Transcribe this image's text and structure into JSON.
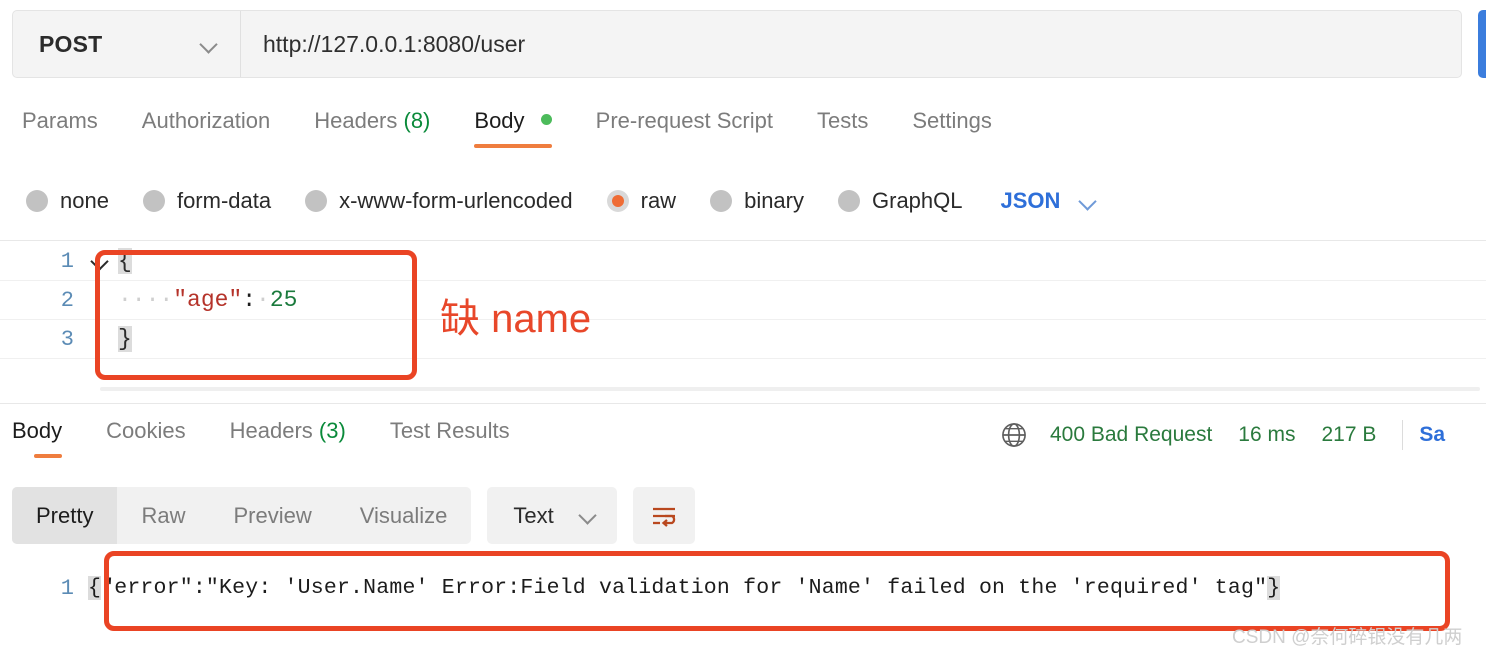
{
  "request": {
    "method": "POST",
    "url": "http://127.0.0.1:8080/user",
    "send_label": "",
    "tabs": [
      {
        "label": "Params",
        "count": "",
        "active": false,
        "dot": false
      },
      {
        "label": "Authorization",
        "count": "",
        "active": false,
        "dot": false
      },
      {
        "label": "Headers",
        "count": "(8)",
        "active": false,
        "dot": false
      },
      {
        "label": "Body",
        "count": "",
        "active": true,
        "dot": true
      },
      {
        "label": "Pre-request Script",
        "count": "",
        "active": false,
        "dot": false
      },
      {
        "label": "Tests",
        "count": "",
        "active": false,
        "dot": false
      },
      {
        "label": "Settings",
        "count": "",
        "active": false,
        "dot": false
      }
    ],
    "body_types": [
      {
        "label": "none",
        "checked": false
      },
      {
        "label": "form-data",
        "checked": false
      },
      {
        "label": "x-www-form-urlencoded",
        "checked": false
      },
      {
        "label": "raw",
        "checked": true
      },
      {
        "label": "binary",
        "checked": false
      },
      {
        "label": "GraphQL",
        "checked": false
      }
    ],
    "raw_format": "JSON"
  },
  "editor": {
    "lines": [
      {
        "num": "1",
        "fold": true,
        "open_brace": "{",
        "indent": "",
        "key": "",
        "colon": "",
        "value": "",
        "close_brace": ""
      },
      {
        "num": "2",
        "fold": false,
        "open_brace": "",
        "indent": "····",
        "key": "\"age\"",
        "colon": ":",
        "value": "25",
        "close_brace": ""
      },
      {
        "num": "3",
        "fold": false,
        "open_brace": "",
        "indent": "",
        "key": "",
        "colon": "",
        "value": "",
        "close_brace": "}"
      }
    ],
    "annotation": "缺 name"
  },
  "response": {
    "tabs": [
      {
        "label": "Body",
        "count": "",
        "active": true
      },
      {
        "label": "Cookies",
        "count": "",
        "active": false
      },
      {
        "label": "Headers",
        "count": "(3)",
        "active": false
      },
      {
        "label": "Test Results",
        "count": "",
        "active": false
      }
    ],
    "status": "400 Bad Request",
    "time": "16 ms",
    "size": "217 B",
    "save_response": "Sa",
    "view_modes": [
      {
        "label": "Pretty",
        "active": true
      },
      {
        "label": "Raw",
        "active": false
      },
      {
        "label": "Preview",
        "active": false
      },
      {
        "label": "Visualize",
        "active": false
      }
    ],
    "format": "Text",
    "body_line_number": "1",
    "body_open_brace": "{",
    "body_text": "\"error\":\"Key: 'User.Name' Error:Field validation for 'Name' failed on the 'required' tag\"",
    "body_close_brace": "}"
  },
  "watermark": "CSDN @奈何碎银没有几两",
  "colors": {
    "accent_orange": "#ef7d3e",
    "radio_orange": "#ef6c35",
    "callout_red": "#ea4424",
    "annotation_red": "#e8472a",
    "link_blue": "#2e6fd9",
    "send_blue": "#3b7ddd",
    "status_green": "#2a7a3d",
    "count_green": "#0a8a3a",
    "line_number_blue": "#5b8bb5",
    "json_key_red": "#b5332a",
    "json_number_green": "#1a7a3c"
  }
}
